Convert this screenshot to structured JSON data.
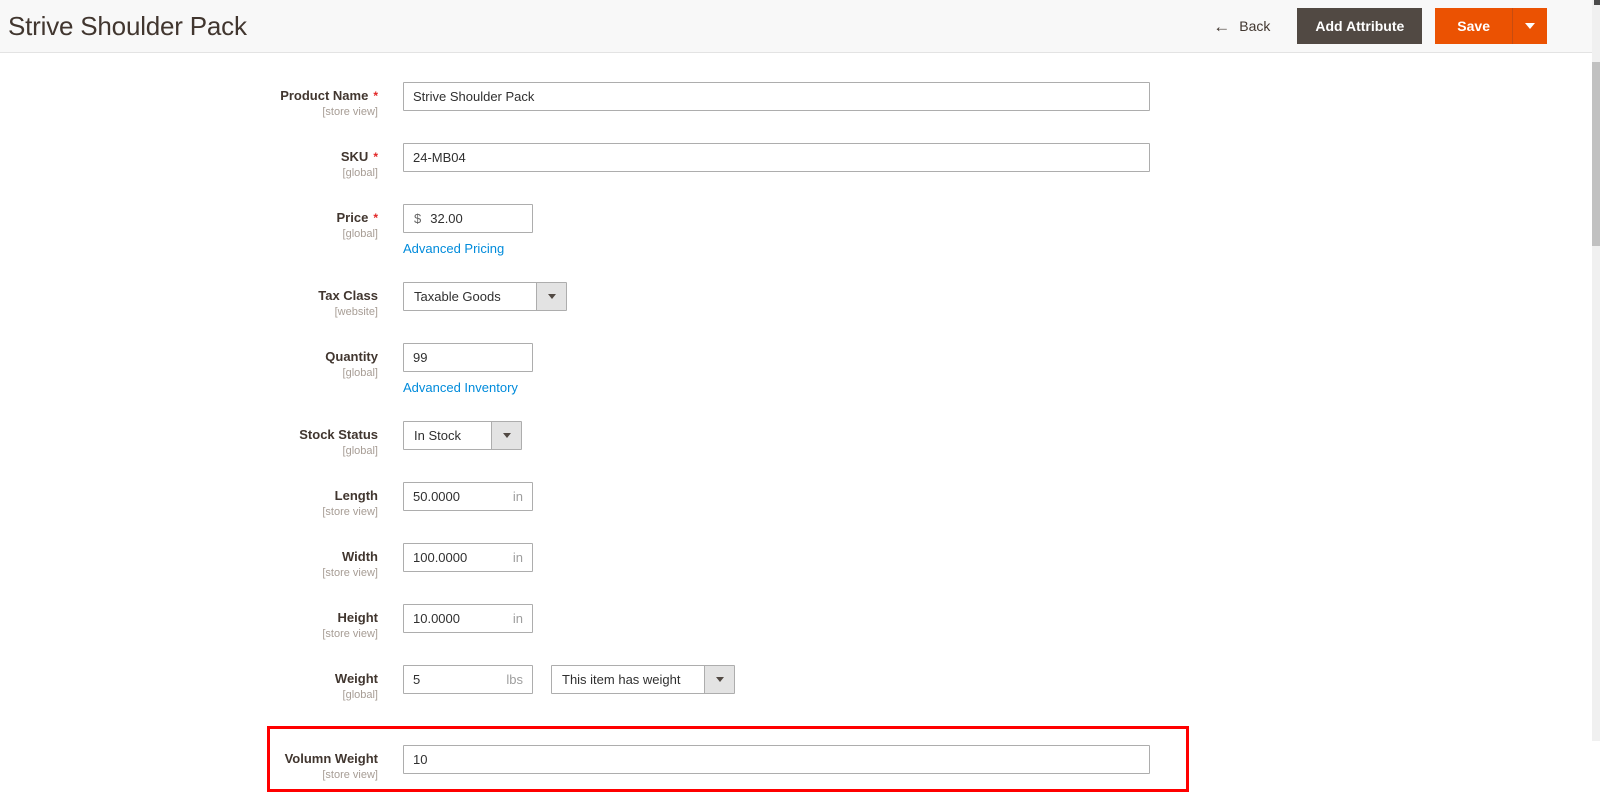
{
  "header": {
    "title": "Strive Shoulder Pack",
    "back_label": "Back",
    "back_icon": "←",
    "add_attribute_label": "Add Attribute",
    "save_label": "Save"
  },
  "colors": {
    "accent_orange": "#eb5202",
    "dark_button": "#514943",
    "link_blue": "#008bdb",
    "required_red": "#e22626",
    "annotation_red": "#ff0000",
    "label_text": "#41362f",
    "scope_text": "#a79d95",
    "input_border": "#adadad"
  },
  "form": {
    "fields": [
      {
        "label": "Product Name",
        "required": "*",
        "scope": "[store view]",
        "value": "Strive Shoulder Pack"
      },
      {
        "label": "SKU",
        "required": "*",
        "scope": "[global]",
        "value": "24-MB04"
      },
      {
        "label": "Price",
        "required": "*",
        "scope": "[global]",
        "prefix": "$",
        "value": "32.00",
        "link": "Advanced Pricing"
      },
      {
        "label": "Tax Class",
        "scope": "[website]",
        "value": "Taxable Goods"
      },
      {
        "label": "Quantity",
        "scope": "[global]",
        "value": "99",
        "link": "Advanced Inventory"
      },
      {
        "label": "Stock Status",
        "scope": "[global]",
        "value": "In Stock"
      },
      {
        "label": "Length",
        "scope": "[store view]",
        "value": "50.0000",
        "suffix": "in"
      },
      {
        "label": "Width",
        "scope": "[store view]",
        "value": "100.0000",
        "suffix": "in"
      },
      {
        "label": "Height",
        "scope": "[store view]",
        "value": "10.0000",
        "suffix": "in"
      },
      {
        "label": "Weight",
        "scope": "[global]",
        "value": "5",
        "suffix": "lbs",
        "select_value": "This item has weight"
      },
      {
        "label": "Volumn Weight",
        "scope": "[store view]",
        "value": "10"
      }
    ]
  }
}
